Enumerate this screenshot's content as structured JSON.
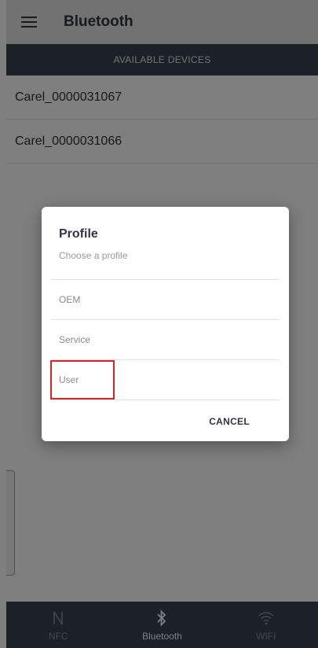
{
  "appbar": {
    "title": "Bluetooth"
  },
  "subheader": {
    "label": "AVAILABLE DEVICES"
  },
  "devices": [
    {
      "name": "Carel_0000031067"
    },
    {
      "name": "Carel_0000031066"
    }
  ],
  "dialog": {
    "title": "Profile",
    "subtitle": "Choose a profile",
    "options": [
      {
        "label": "OEM"
      },
      {
        "label": "Service"
      },
      {
        "label": "User",
        "highlighted": true
      }
    ],
    "cancel_label": "CANCEL",
    "highlight_color": "#e02222"
  },
  "bottom_nav": {
    "items": [
      {
        "label": "NFC",
        "icon": "nfc-icon",
        "active": false
      },
      {
        "label": "Bluetooth",
        "icon": "bluetooth-icon",
        "active": true
      },
      {
        "label": "WIFI",
        "icon": "wifi-icon",
        "active": false
      }
    ]
  },
  "colors": {
    "appbar_bg": "#e4e4e4",
    "dark_bar": "#38414f",
    "scrim": "rgba(0,0,0,0.5)"
  }
}
